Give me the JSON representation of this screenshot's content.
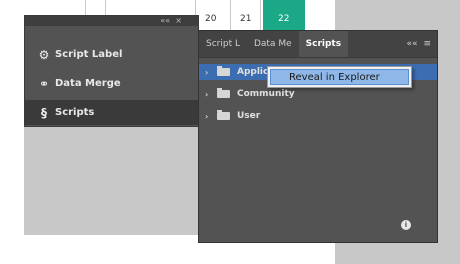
{
  "document": {
    "column_numbers": [
      "20",
      "21",
      "22"
    ]
  },
  "small_panel": {
    "controls": [
      "««",
      "×",
      "≡"
    ],
    "items": [
      {
        "label": "Script Label",
        "icon": "script-label-icon"
      },
      {
        "label": "Data Merge",
        "icon": "data-merge-icon"
      },
      {
        "label": "Scripts",
        "icon": "scripts-icon"
      }
    ]
  },
  "scripts_panel": {
    "tabs": [
      "Script L",
      "Data Me",
      "Scripts"
    ],
    "active_tab": "Scripts",
    "tab_tools": [
      "««",
      "≡"
    ],
    "tree": [
      {
        "label": "Application"
      },
      {
        "label": "Community"
      },
      {
        "label": "User"
      }
    ]
  },
  "context_menu": {
    "item": "Reveal in Explorer"
  },
  "colors": {
    "panel_bg": "#535353",
    "selection": "#3d6db1",
    "menu_highlight": "#8fb8e8",
    "doc_accent": "#1aa886"
  }
}
